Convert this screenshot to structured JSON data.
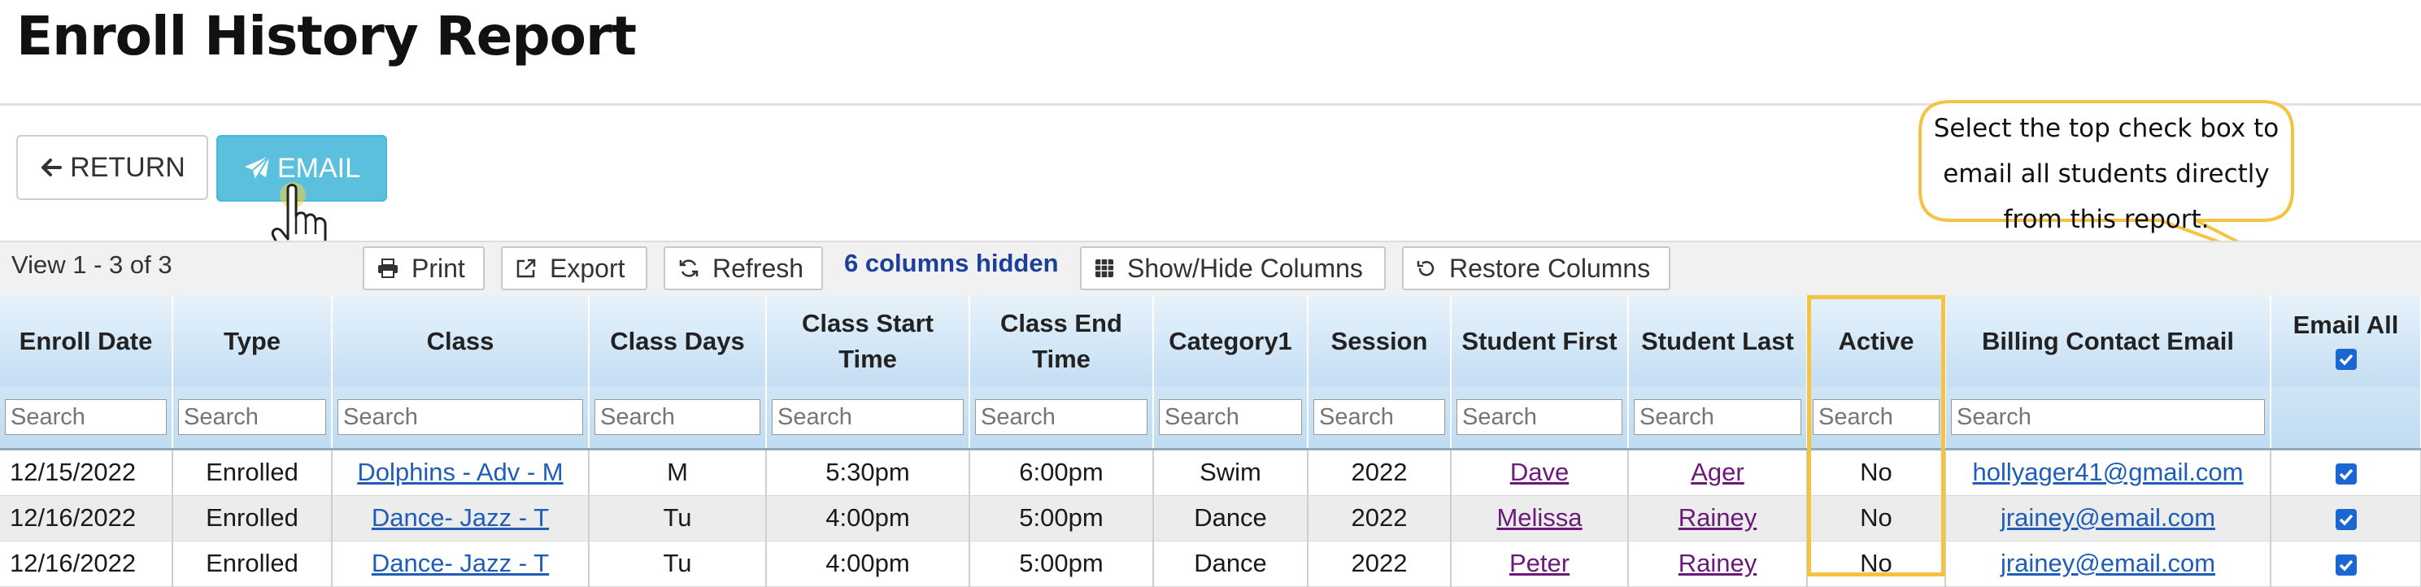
{
  "page_title": "Enroll History Report",
  "buttons": {
    "return_label": "RETURN",
    "email_label": "EMAIL"
  },
  "callout": {
    "text": "Select the top check box to email all students directly from this report."
  },
  "toolbar": {
    "view_count": "View 1 - 3 of 3",
    "print_label": "Print",
    "export_label": "Export",
    "refresh_label": "Refresh",
    "hidden_columns": "6 columns hidden",
    "show_hide_label": "Show/Hide Columns",
    "restore_label": "Restore Columns"
  },
  "table": {
    "columns": [
      "Enroll Date",
      "Type",
      "Class",
      "Class Days",
      "Class Start Time",
      "Class End Time",
      "Category1",
      "Session",
      "Student First",
      "Student Last",
      "Active",
      "Billing Contact Email",
      "Email All"
    ],
    "email_all_checked": true,
    "filter_placeholder": "Search",
    "rows": [
      {
        "enroll_date": "12/15/2022",
        "type": "Enrolled",
        "class": "Dolphins - Adv - M",
        "days": "M",
        "start": "5:30pm",
        "end": "6:00pm",
        "category": "Swim",
        "session": "2022",
        "first": "Dave",
        "last": "Ager",
        "active": "No",
        "email": "hollyager41@gmail.com",
        "checked": true
      },
      {
        "enroll_date": "12/16/2022",
        "type": "Enrolled",
        "class": "Dance- Jazz - T",
        "days": "Tu",
        "start": "4:00pm",
        "end": "5:00pm",
        "category": "Dance",
        "session": "2022",
        "first": "Melissa",
        "last": "Rainey",
        "active": "No",
        "email": "jrainey@email.com",
        "checked": true
      },
      {
        "enroll_date": "12/16/2022",
        "type": "Enrolled",
        "class": "Dance- Jazz - T",
        "days": "Tu",
        "start": "4:00pm",
        "end": "5:00pm",
        "category": "Dance",
        "session": "2022",
        "first": "Peter",
        "last": "Rainey",
        "active": "No",
        "email": "jrainey@email.com",
        "checked": true
      }
    ]
  },
  "colors": {
    "email_button": "#5bc0de",
    "highlight": "#f5c242",
    "link": "#1f5db8",
    "visited_link": "#6b1a7a",
    "header_gradient_top": "#e6f2fb",
    "header_gradient_bottom": "#c4def3"
  },
  "icons": [
    "arrow-left-icon",
    "paper-plane-icon",
    "pointer-hand-icon",
    "print-icon",
    "export-icon",
    "refresh-icon",
    "columns-icon",
    "restore-icon",
    "checkbox-icon"
  ]
}
